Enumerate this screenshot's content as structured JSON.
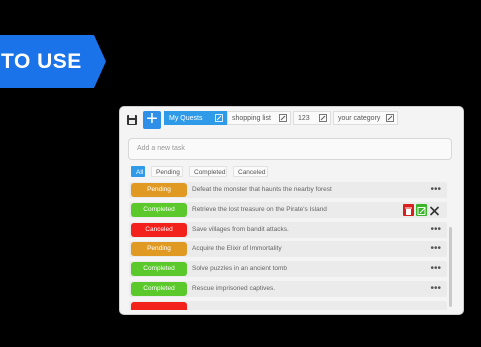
{
  "banner": {
    "text": "TO USE",
    "color": "#1a73e8"
  },
  "toolbar": {
    "save_icon": "floppy-disk-icon",
    "add_label": "+",
    "tabs": [
      {
        "label": "My Quests",
        "active": true
      },
      {
        "label": "shopping list",
        "active": false
      },
      {
        "label": "123",
        "active": false
      },
      {
        "label": "your category",
        "active": false
      }
    ]
  },
  "input": {
    "placeholder": "Add a new task"
  },
  "filters": [
    {
      "label": "All",
      "active": true
    },
    {
      "label": "Pending",
      "active": false
    },
    {
      "label": "Completed",
      "active": false
    },
    {
      "label": "Canceled",
      "active": false
    }
  ],
  "status_colors": {
    "Pending": "#e09a23",
    "Completed": "#5bc82b",
    "Canceled": "#f2211b"
  },
  "tasks": [
    {
      "status": "Pending",
      "text": "Defeat the monster that haunts the nearby forest"
    },
    {
      "status": "Completed",
      "text": "Retrieve the lost treasure on the Pirate's Island",
      "hover": true
    },
    {
      "status": "Canceled",
      "text": "Save villages from bandit attacks."
    },
    {
      "status": "Pending",
      "text": "Acquire the Elixir of Immortality"
    },
    {
      "status": "Completed",
      "text": "Solve puzzles in an ancient tomb"
    },
    {
      "status": "Completed",
      "text": "Rescue imprisoned captives."
    }
  ],
  "menu_glyph": "•••"
}
